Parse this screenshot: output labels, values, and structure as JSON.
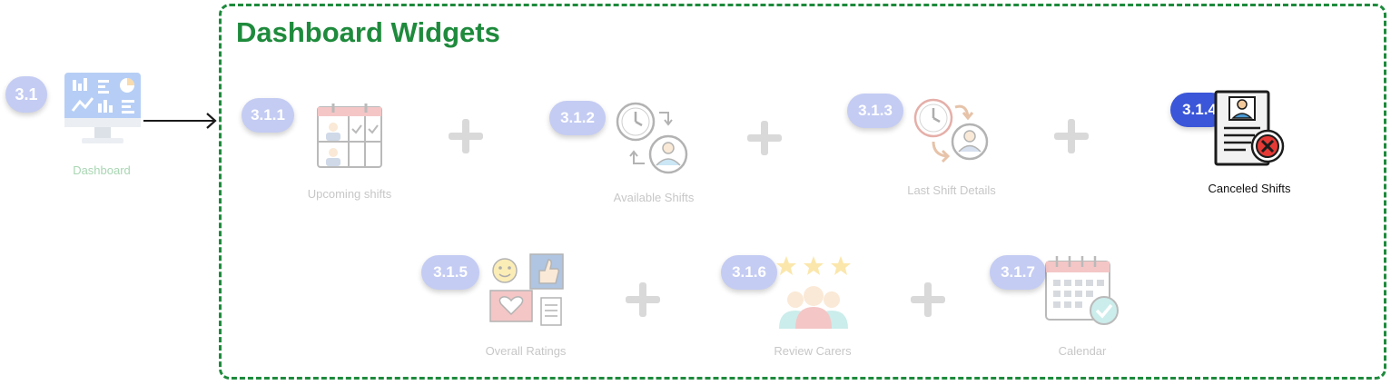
{
  "root": {
    "badge": "3.1",
    "label": "Dashboard"
  },
  "section": {
    "title": "Dashboard Widgets"
  },
  "widgets": [
    {
      "id": "3.1.1",
      "label": "Upcoming shifts",
      "icon": "calendar-staff-icon",
      "state": "faded"
    },
    {
      "id": "3.1.2",
      "label": "Available Shifts",
      "icon": "clock-person-icon",
      "state": "faded"
    },
    {
      "id": "3.1.3",
      "label": "Last Shift Details",
      "icon": "clock-history-person-icon",
      "state": "faded"
    },
    {
      "id": "3.1.4",
      "label": "Canceled Shifts",
      "icon": "canceled-document-icon",
      "state": "active"
    },
    {
      "id": "3.1.5",
      "label": "Overall Ratings",
      "icon": "ratings-feedback-icon",
      "state": "faded"
    },
    {
      "id": "3.1.6",
      "label": "Review Carers",
      "icon": "review-carers-icon",
      "state": "faded"
    },
    {
      "id": "3.1.7",
      "label": "Calendar",
      "icon": "calendar-check-icon",
      "state": "faded"
    }
  ],
  "colors": {
    "frame": "#1e8a3c",
    "badge_active": "#3b56d8",
    "badge_faded": "#c4ccf3",
    "plus": "#d9d9d9"
  }
}
